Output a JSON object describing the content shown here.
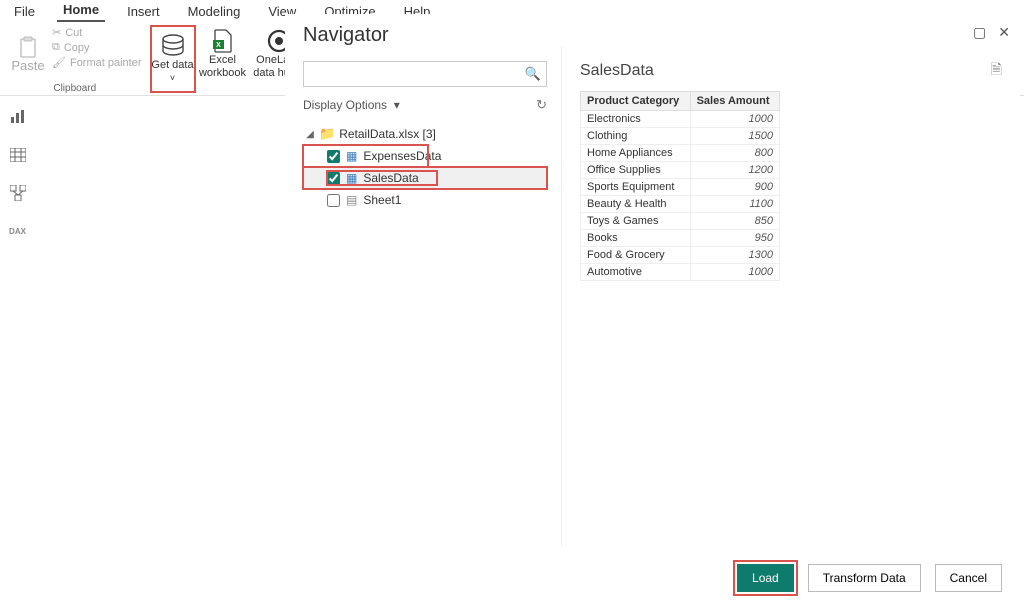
{
  "tabs": {
    "file": "File",
    "home": "Home",
    "insert": "Insert",
    "modeling": "Modeling",
    "view": "View",
    "optimize": "Optimize",
    "help": "Help"
  },
  "ribbon": {
    "clipboard_label": "Clipboard",
    "paste": "Paste",
    "cut": "Cut",
    "copy": "Copy",
    "format_painter": "Format painter",
    "get_data": "Get data",
    "excel_workbook": "Excel workbook",
    "onelake": "OneLake data hub"
  },
  "navigator": {
    "title": "Navigator",
    "search_placeholder": "",
    "display_options": "Display Options",
    "root": "RetailData.xlsx [3]",
    "items": [
      {
        "label": "ExpensesData",
        "checked": true
      },
      {
        "label": "SalesData",
        "checked": true
      },
      {
        "label": "Sheet1",
        "checked": false
      }
    ],
    "preview_title": "SalesData",
    "columns": [
      "Product Category",
      "Sales Amount"
    ],
    "rows": [
      [
        "Electronics",
        "1000"
      ],
      [
        "Clothing",
        "1500"
      ],
      [
        "Home Appliances",
        "800"
      ],
      [
        "Office Supplies",
        "1200"
      ],
      [
        "Sports Equipment",
        "900"
      ],
      [
        "Beauty & Health",
        "1100"
      ],
      [
        "Toys & Games",
        "850"
      ],
      [
        "Books",
        "950"
      ],
      [
        "Food & Grocery",
        "1300"
      ],
      [
        "Automotive",
        "1000"
      ]
    ],
    "buttons": {
      "load": "Load",
      "transform": "Transform Data",
      "cancel": "Cancel"
    }
  }
}
